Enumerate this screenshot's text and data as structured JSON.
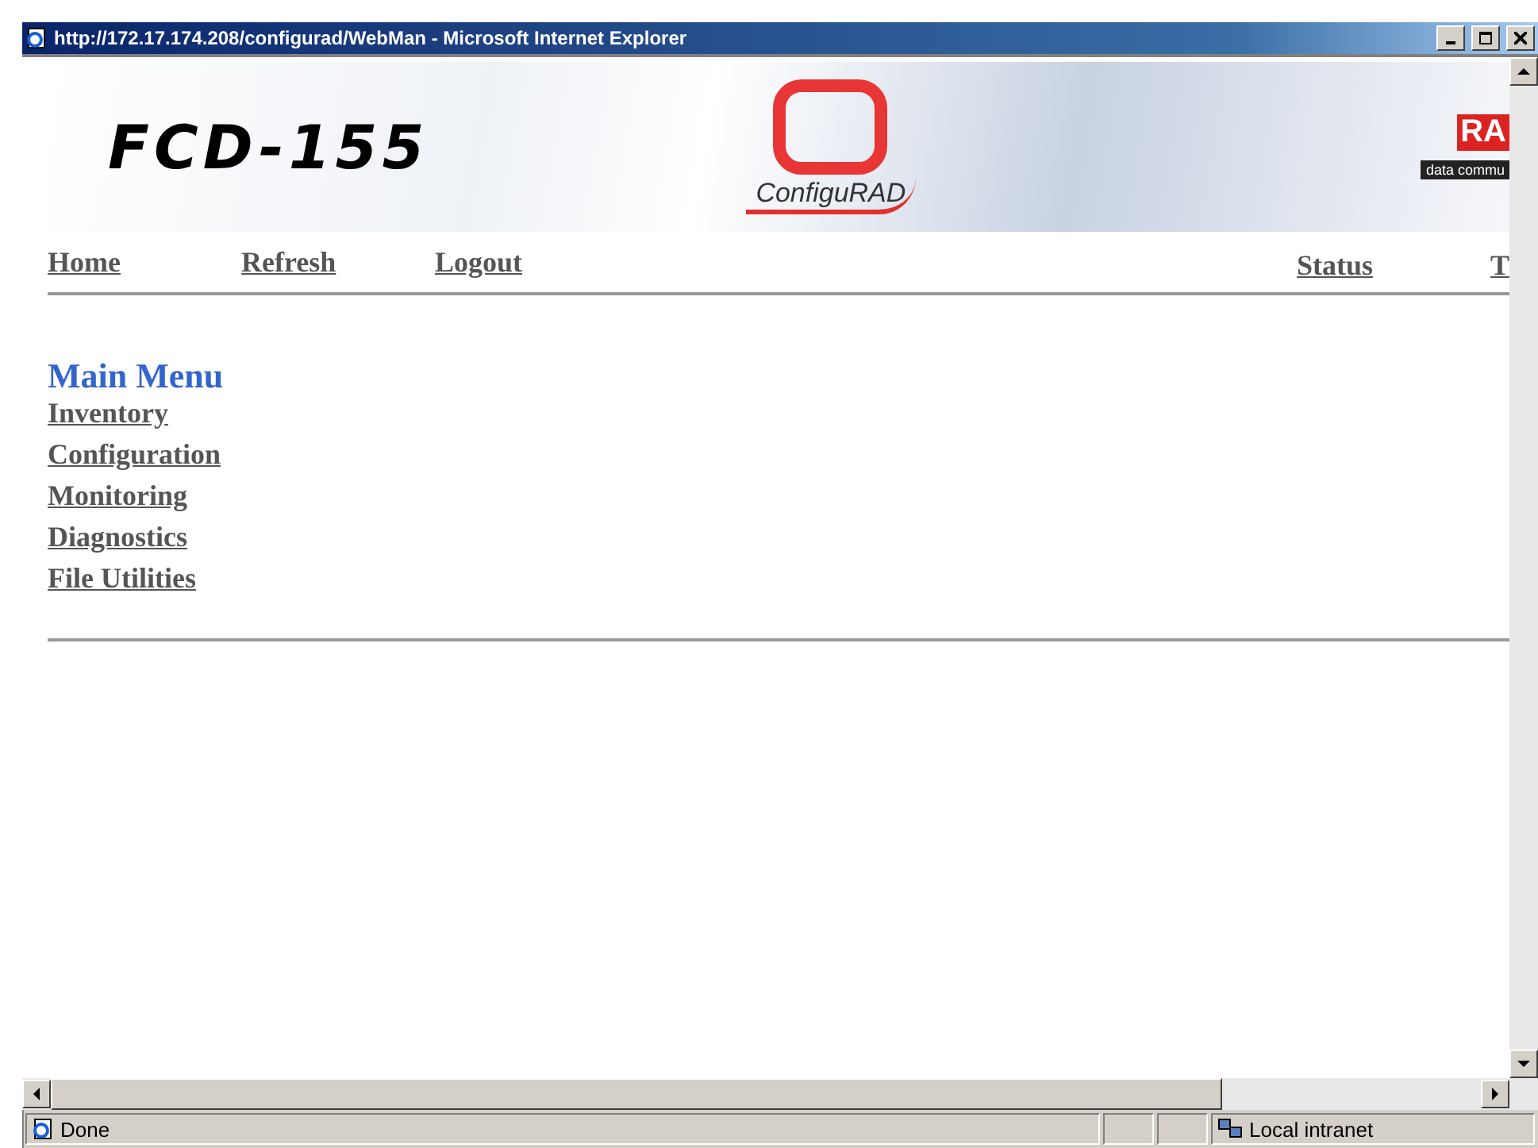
{
  "window": {
    "title": "http://172.17.174.208/configurad/WebMan - Microsoft Internet Explorer"
  },
  "banner": {
    "product": "FCD-155",
    "logo_text": "ConfiguRAD",
    "brand": "RA",
    "tagline": "data commu"
  },
  "nav": {
    "left": [
      "Home",
      "Refresh",
      "Logout"
    ],
    "right": [
      "Status",
      "T"
    ]
  },
  "menu": {
    "title": "Main Menu",
    "items": [
      "Inventory",
      "Configuration",
      "Monitoring",
      "Diagnostics",
      "File Utilities"
    ]
  },
  "status_bar": {
    "text": "Done",
    "zone": "Local intranet"
  }
}
